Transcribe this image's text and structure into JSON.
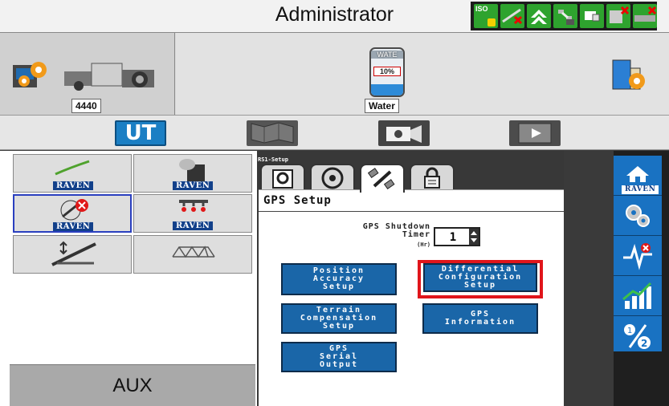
{
  "title": "Administrator",
  "status_icons": [
    {
      "name": "iso-status-icon",
      "text": "ISO"
    },
    {
      "name": "gps-error-icon"
    },
    {
      "name": "boom-up-icon"
    },
    {
      "name": "satellite-status-icon"
    },
    {
      "name": "display-icon"
    },
    {
      "name": "calculator-error-icon"
    },
    {
      "name": "implement-error-icon"
    }
  ],
  "tractor": {
    "number": "4440"
  },
  "tank": {
    "name": "WATE",
    "percent": "10%",
    "label": "Water",
    "fill_fraction": 0.1
  },
  "nav_tabs": [
    {
      "name": "tab-universal-terminal",
      "label": "UT",
      "selected": true
    },
    {
      "name": "tab-map"
    },
    {
      "name": "tab-camera"
    },
    {
      "name": "tab-video"
    }
  ],
  "left_grid": {
    "brand": "RAVEN",
    "aux_label": "AUX"
  },
  "center": {
    "screen_id": "RS1-Setup",
    "tabs": [
      "settings",
      "steering-wheel",
      "gps-satellite",
      "lock"
    ],
    "active_tab": 2,
    "heading": "GPS Setup",
    "shutdown_label": "GPS Shutdown\nTimer",
    "shutdown_unit": "(Hr)",
    "shutdown_value": "1",
    "buttons": {
      "position_accuracy": "Position\nAccuracy\nSetup",
      "differential": "Differential\nConfiguration\nSetup",
      "terrain": "Terrain\nCompensation\nSetup",
      "gps_info": "GPS\nInformation",
      "serial": "GPS\nSerial\nOutput"
    }
  },
  "sidebar": {
    "home_label": "RAVEN",
    "items": [
      "home-icon",
      "settings-gears-icon",
      "diagnostics-icon",
      "performance-chart-icon",
      "toggle-1-2-icon"
    ]
  },
  "colors": {
    "button_blue": "#1a66a8",
    "highlight_red": "#e0151b",
    "raven_blue": "#12408a",
    "sidebar_blue": "#1972c2"
  }
}
